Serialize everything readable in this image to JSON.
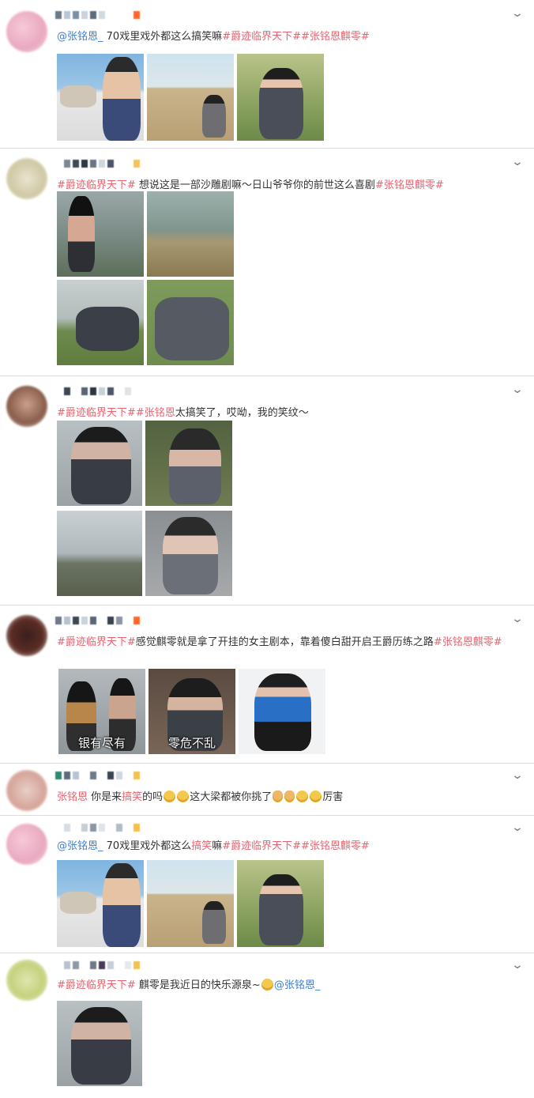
{
  "posts": [
    {
      "segments": [
        {
          "t": "@张铭恩_",
          "c": "mention"
        },
        {
          "t": " 70戏里戏外都这么搞笑嘛",
          "c": ""
        },
        {
          "t": "#爵迹临界天下#",
          "c": "tag"
        },
        {
          "t": "#张铭恩麒零#",
          "c": "tag"
        }
      ]
    },
    {
      "segments": [
        {
          "t": "#爵迹临界天下#",
          "c": "tag"
        },
        {
          "t": " 想说这是一部沙雕剧嘛～日山爷爷你的前世这么喜剧",
          "c": ""
        },
        {
          "t": "#张铭恩麒零#",
          "c": "tag"
        }
      ]
    },
    {
      "segments": [
        {
          "t": "#爵迹临界天下#",
          "c": "tag"
        },
        {
          "t": "#张铭恩",
          "c": "tag"
        },
        {
          "t": "太搞笑了，哎呦，我的笑纹～",
          "c": ""
        }
      ]
    },
    {
      "segments": [
        {
          "t": "#爵迹临界天下#",
          "c": "tag"
        },
        {
          "t": "感觉麒零就是拿了开挂的女主剧本，靠着傻白甜开启王爵历练之路",
          "c": ""
        },
        {
          "t": "#张铭恩麒零#",
          "c": "tag"
        }
      ],
      "captions": [
        "银有尽有",
        "零危不乱"
      ]
    },
    {
      "segments": [
        {
          "t": "张铭恩",
          "c": "tag"
        },
        {
          "t": " 你是来",
          "c": ""
        },
        {
          "t": "搞笑",
          "c": "kw"
        },
        {
          "t": "的吗",
          "c": ""
        },
        {
          "t": "",
          "c": "emo"
        },
        {
          "t": "",
          "c": "emo"
        },
        {
          "t": "这大梁都被你挑了",
          "c": ""
        },
        {
          "t": "",
          "c": "emo hand"
        },
        {
          "t": "",
          "c": "emo hand"
        },
        {
          "t": "",
          "c": "emo"
        },
        {
          "t": "",
          "c": "emo"
        },
        {
          "t": "厉害",
          "c": ""
        }
      ]
    },
    {
      "segments": [
        {
          "t": "@张铭恩_",
          "c": "mention"
        },
        {
          "t": " 70戏里戏外都这么",
          "c": ""
        },
        {
          "t": "搞笑",
          "c": "kw"
        },
        {
          "t": "嘛",
          "c": ""
        },
        {
          "t": "#爵迹临界天下#",
          "c": "tag"
        },
        {
          "t": "#张铭恩麒零#",
          "c": "tag"
        }
      ]
    },
    {
      "segments": [
        {
          "t": "#爵迹临界天下#",
          "c": "tag"
        },
        {
          "t": " 麒零是我近日的快乐源泉~",
          "c": ""
        },
        {
          "t": "",
          "c": "emo"
        },
        {
          "t": "@张铭恩_",
          "c": "mention"
        }
      ]
    }
  ],
  "icons": {
    "menu": "chevron-down-icon"
  },
  "colors": {
    "tag": "#e8636f",
    "mention": "#3d7fcf",
    "background": "#e9e9e9"
  }
}
